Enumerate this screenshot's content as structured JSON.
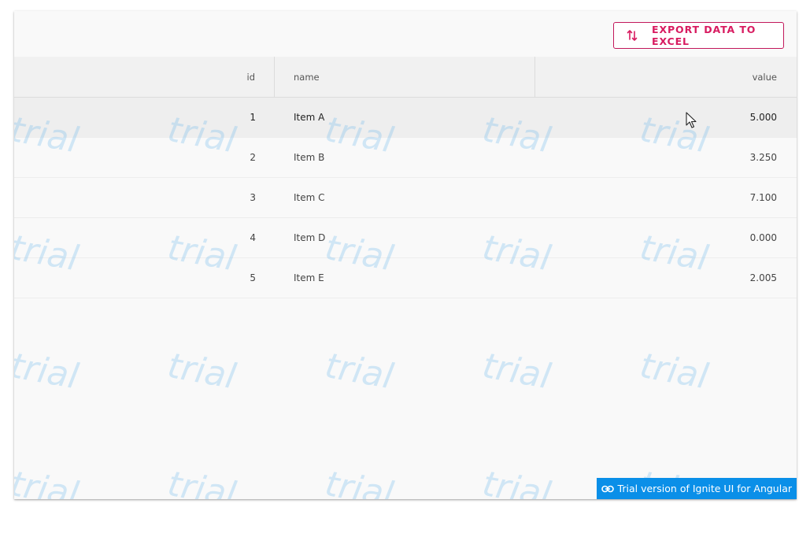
{
  "toolbar": {
    "export_label": "EXPORT DATA TO EXCEL",
    "export_icon": "swap-vert-icon"
  },
  "columns": [
    "id",
    "name",
    "value"
  ],
  "rows": [
    {
      "id": "1",
      "name": "Item A",
      "value": "5.000"
    },
    {
      "id": "2",
      "name": "Item B",
      "value": "3.250"
    },
    {
      "id": "3",
      "name": "Item C",
      "value": "7.100"
    },
    {
      "id": "4",
      "name": "Item D",
      "value": "0.000"
    },
    {
      "id": "5",
      "name": "Item E",
      "value": "2.005"
    }
  ],
  "hovered_row": 0,
  "watermark": "trial",
  "trial_link": {
    "label": "Trial version of Ignite UI for Angular",
    "icon": "link-icon"
  },
  "colors": {
    "accent": "#d81b60",
    "trial_banner": "#0a8fe8"
  }
}
